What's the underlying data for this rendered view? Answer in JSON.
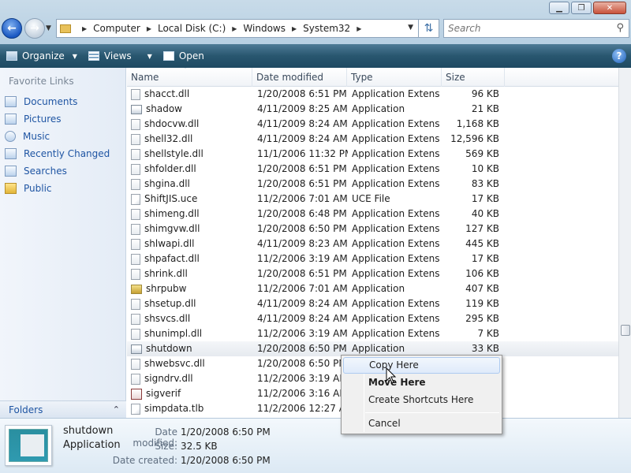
{
  "window": {
    "minimize": "▁",
    "maximize": "❐",
    "close": "✕"
  },
  "address": {
    "crumbs": [
      "Computer",
      "Local Disk (C:)",
      "Windows",
      "System32"
    ]
  },
  "search": {
    "placeholder": "Search"
  },
  "toolbar": {
    "organize": "Organize",
    "views": "Views",
    "open": "Open",
    "help": "?"
  },
  "sidebar": {
    "heading": "Favorite Links",
    "items": [
      {
        "label": "Documents",
        "icon": "documents-icon"
      },
      {
        "label": "Pictures",
        "icon": "pictures-icon"
      },
      {
        "label": "Music",
        "icon": "music-icon"
      },
      {
        "label": "Recently Changed",
        "icon": "recently-changed-icon"
      },
      {
        "label": "Searches",
        "icon": "searches-icon"
      },
      {
        "label": "Public",
        "icon": "public-folder-icon"
      }
    ],
    "folders_label": "Folders"
  },
  "columns": {
    "name": "Name",
    "date": "Date modified",
    "type": "Type",
    "size": "Size"
  },
  "files": [
    {
      "name": "shacct.dll",
      "date": "1/20/2008 6:51 PM",
      "type": "Application Extens...",
      "size": "96 KB",
      "icon": "dll"
    },
    {
      "name": "shadow",
      "date": "4/11/2009 8:25 AM",
      "type": "Application",
      "size": "21 KB",
      "icon": "app"
    },
    {
      "name": "shdocvw.dll",
      "date": "4/11/2009 8:24 AM",
      "type": "Application Extens...",
      "size": "1,168 KB",
      "icon": "dll"
    },
    {
      "name": "shell32.dll",
      "date": "4/11/2009 8:24 AM",
      "type": "Application Extens...",
      "size": "12,596 KB",
      "icon": "dll"
    },
    {
      "name": "shellstyle.dll",
      "date": "11/1/2006 11:32 PM",
      "type": "Application Extens...",
      "size": "569 KB",
      "icon": "dll"
    },
    {
      "name": "shfolder.dll",
      "date": "1/20/2008 6:51 PM",
      "type": "Application Extens...",
      "size": "10 KB",
      "icon": "dll"
    },
    {
      "name": "shgina.dll",
      "date": "1/20/2008 6:51 PM",
      "type": "Application Extens...",
      "size": "83 KB",
      "icon": "dll"
    },
    {
      "name": "ShiftJIS.uce",
      "date": "11/2/2006 7:01 AM",
      "type": "UCE File",
      "size": "17 KB",
      "icon": "file"
    },
    {
      "name": "shimeng.dll",
      "date": "1/20/2008 6:48 PM",
      "type": "Application Extens...",
      "size": "40 KB",
      "icon": "dll"
    },
    {
      "name": "shimgvw.dll",
      "date": "1/20/2008 6:50 PM",
      "type": "Application Extens...",
      "size": "127 KB",
      "icon": "dll"
    },
    {
      "name": "shlwapi.dll",
      "date": "4/11/2009 8:23 AM",
      "type": "Application Extens...",
      "size": "445 KB",
      "icon": "dll"
    },
    {
      "name": "shpafact.dll",
      "date": "11/2/2006 3:19 AM",
      "type": "Application Extens...",
      "size": "17 KB",
      "icon": "dll"
    },
    {
      "name": "shrink.dll",
      "date": "1/20/2008 6:51 PM",
      "type": "Application Extens...",
      "size": "106 KB",
      "icon": "dll"
    },
    {
      "name": "shrpubw",
      "date": "11/2/2006 7:01 AM",
      "type": "Application",
      "size": "407 KB",
      "icon": "app2"
    },
    {
      "name": "shsetup.dll",
      "date": "4/11/2009 8:24 AM",
      "type": "Application Extens...",
      "size": "119 KB",
      "icon": "dll"
    },
    {
      "name": "shsvcs.dll",
      "date": "4/11/2009 8:24 AM",
      "type": "Application Extens...",
      "size": "295 KB",
      "icon": "dll"
    },
    {
      "name": "shunimpl.dll",
      "date": "11/2/2006 3:19 AM",
      "type": "Application Extens...",
      "size": "7 KB",
      "icon": "dll"
    },
    {
      "name": "shutdown",
      "date": "1/20/2008 6:50 PM",
      "type": "Application",
      "size": "33 KB",
      "icon": "app",
      "selected": true
    },
    {
      "name": "shwebsvc.dll",
      "date": "1/20/2008 6:50 PM",
      "type": "",
      "size": "",
      "icon": "dll"
    },
    {
      "name": "signdrv.dll",
      "date": "11/2/2006 3:19 AM",
      "type": "",
      "size": "",
      "icon": "dll"
    },
    {
      "name": "sigverif",
      "date": "11/2/2006 3:16 AM",
      "type": "",
      "size": "",
      "icon": "app3"
    },
    {
      "name": "simpdata.tlb",
      "date": "11/2/2006 12:27 AM",
      "type": "",
      "size": "",
      "icon": "file"
    }
  ],
  "details": {
    "name": "shutdown",
    "type": "Application",
    "modified_label": "Date modified:",
    "modified_value": "1/20/2008 6:50 PM",
    "size_label": "Size:",
    "size_value": "32.5 KB",
    "created_label": "Date created:",
    "created_value": "1/20/2008 6:50 PM"
  },
  "context_menu": {
    "copy": "Copy Here",
    "move": "Move Here",
    "shortcuts": "Create Shortcuts Here",
    "cancel": "Cancel"
  }
}
